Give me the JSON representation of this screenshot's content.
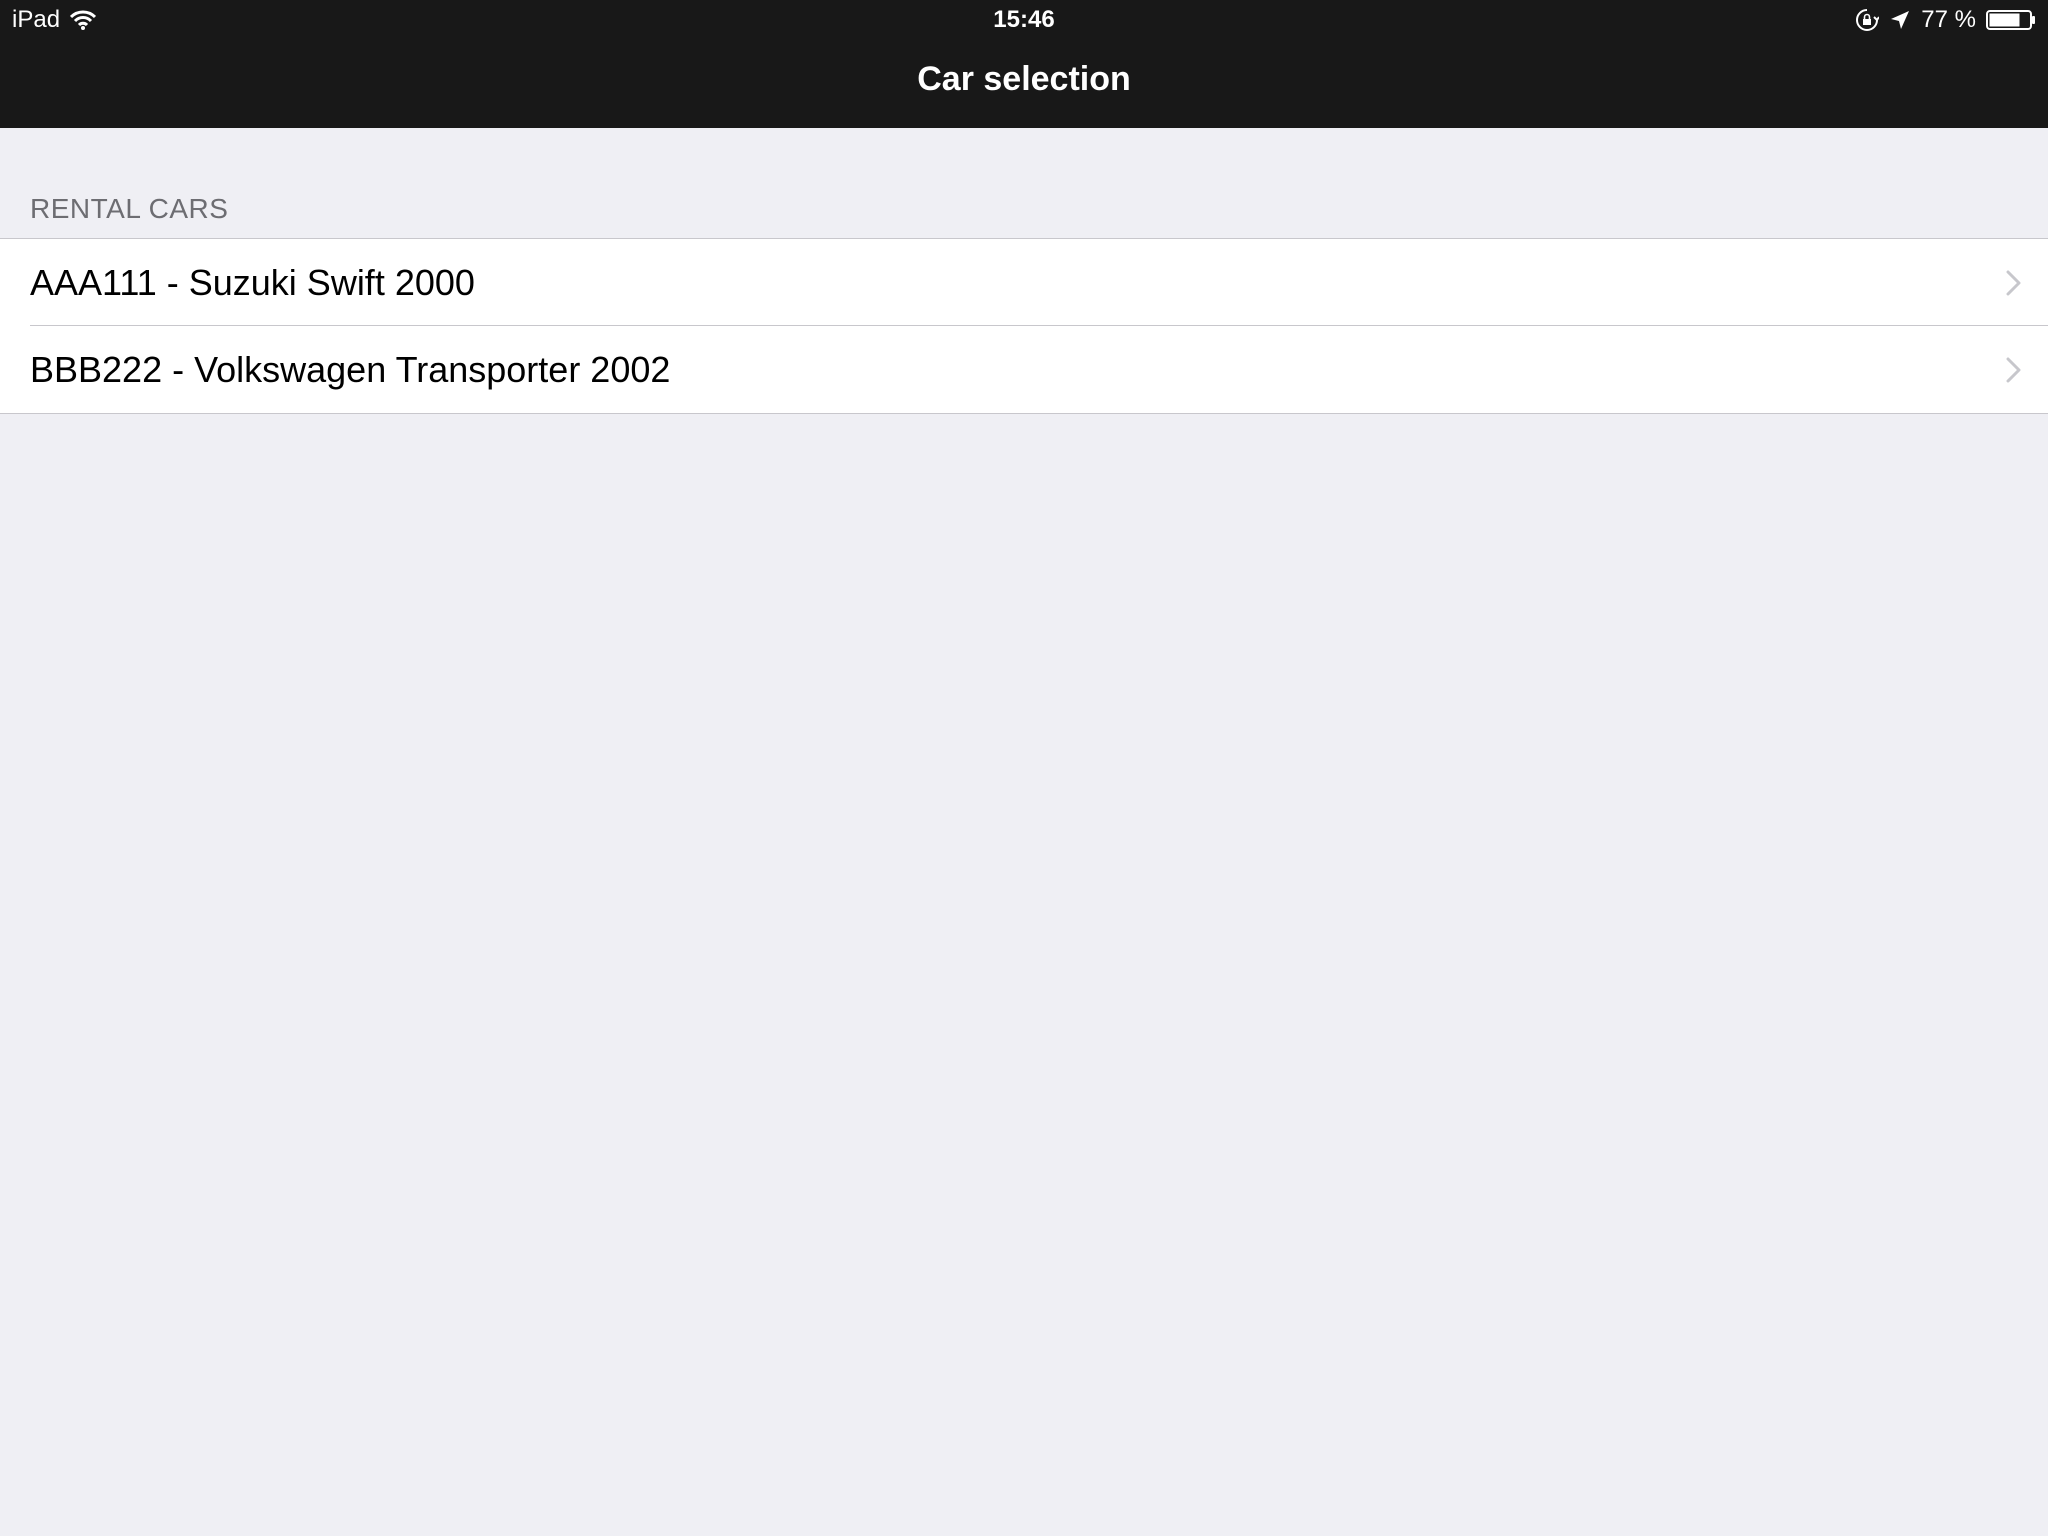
{
  "status_bar": {
    "device": "iPad",
    "time": "15:46",
    "battery_text": "77 %",
    "battery_level": 0.77
  },
  "nav": {
    "title": "Car selection"
  },
  "section": {
    "header": "RENTAL CARS",
    "rows": [
      {
        "label": "AAA111 - Suzuki Swift 2000"
      },
      {
        "label": "BBB222 - Volkswagen Transporter 2002"
      }
    ]
  },
  "colors": {
    "nav_background": "#181818",
    "page_background": "#efeff4",
    "separator": "#c8c7cc",
    "section_header_text": "#6d6d72",
    "chevron": "#c7c7cc"
  },
  "icons": {
    "wifi": "wifi-icon",
    "orientation_lock": "orientation-lock-icon",
    "location": "location-arrow-icon",
    "battery": "battery-icon",
    "chevron": "chevron-right-icon"
  }
}
